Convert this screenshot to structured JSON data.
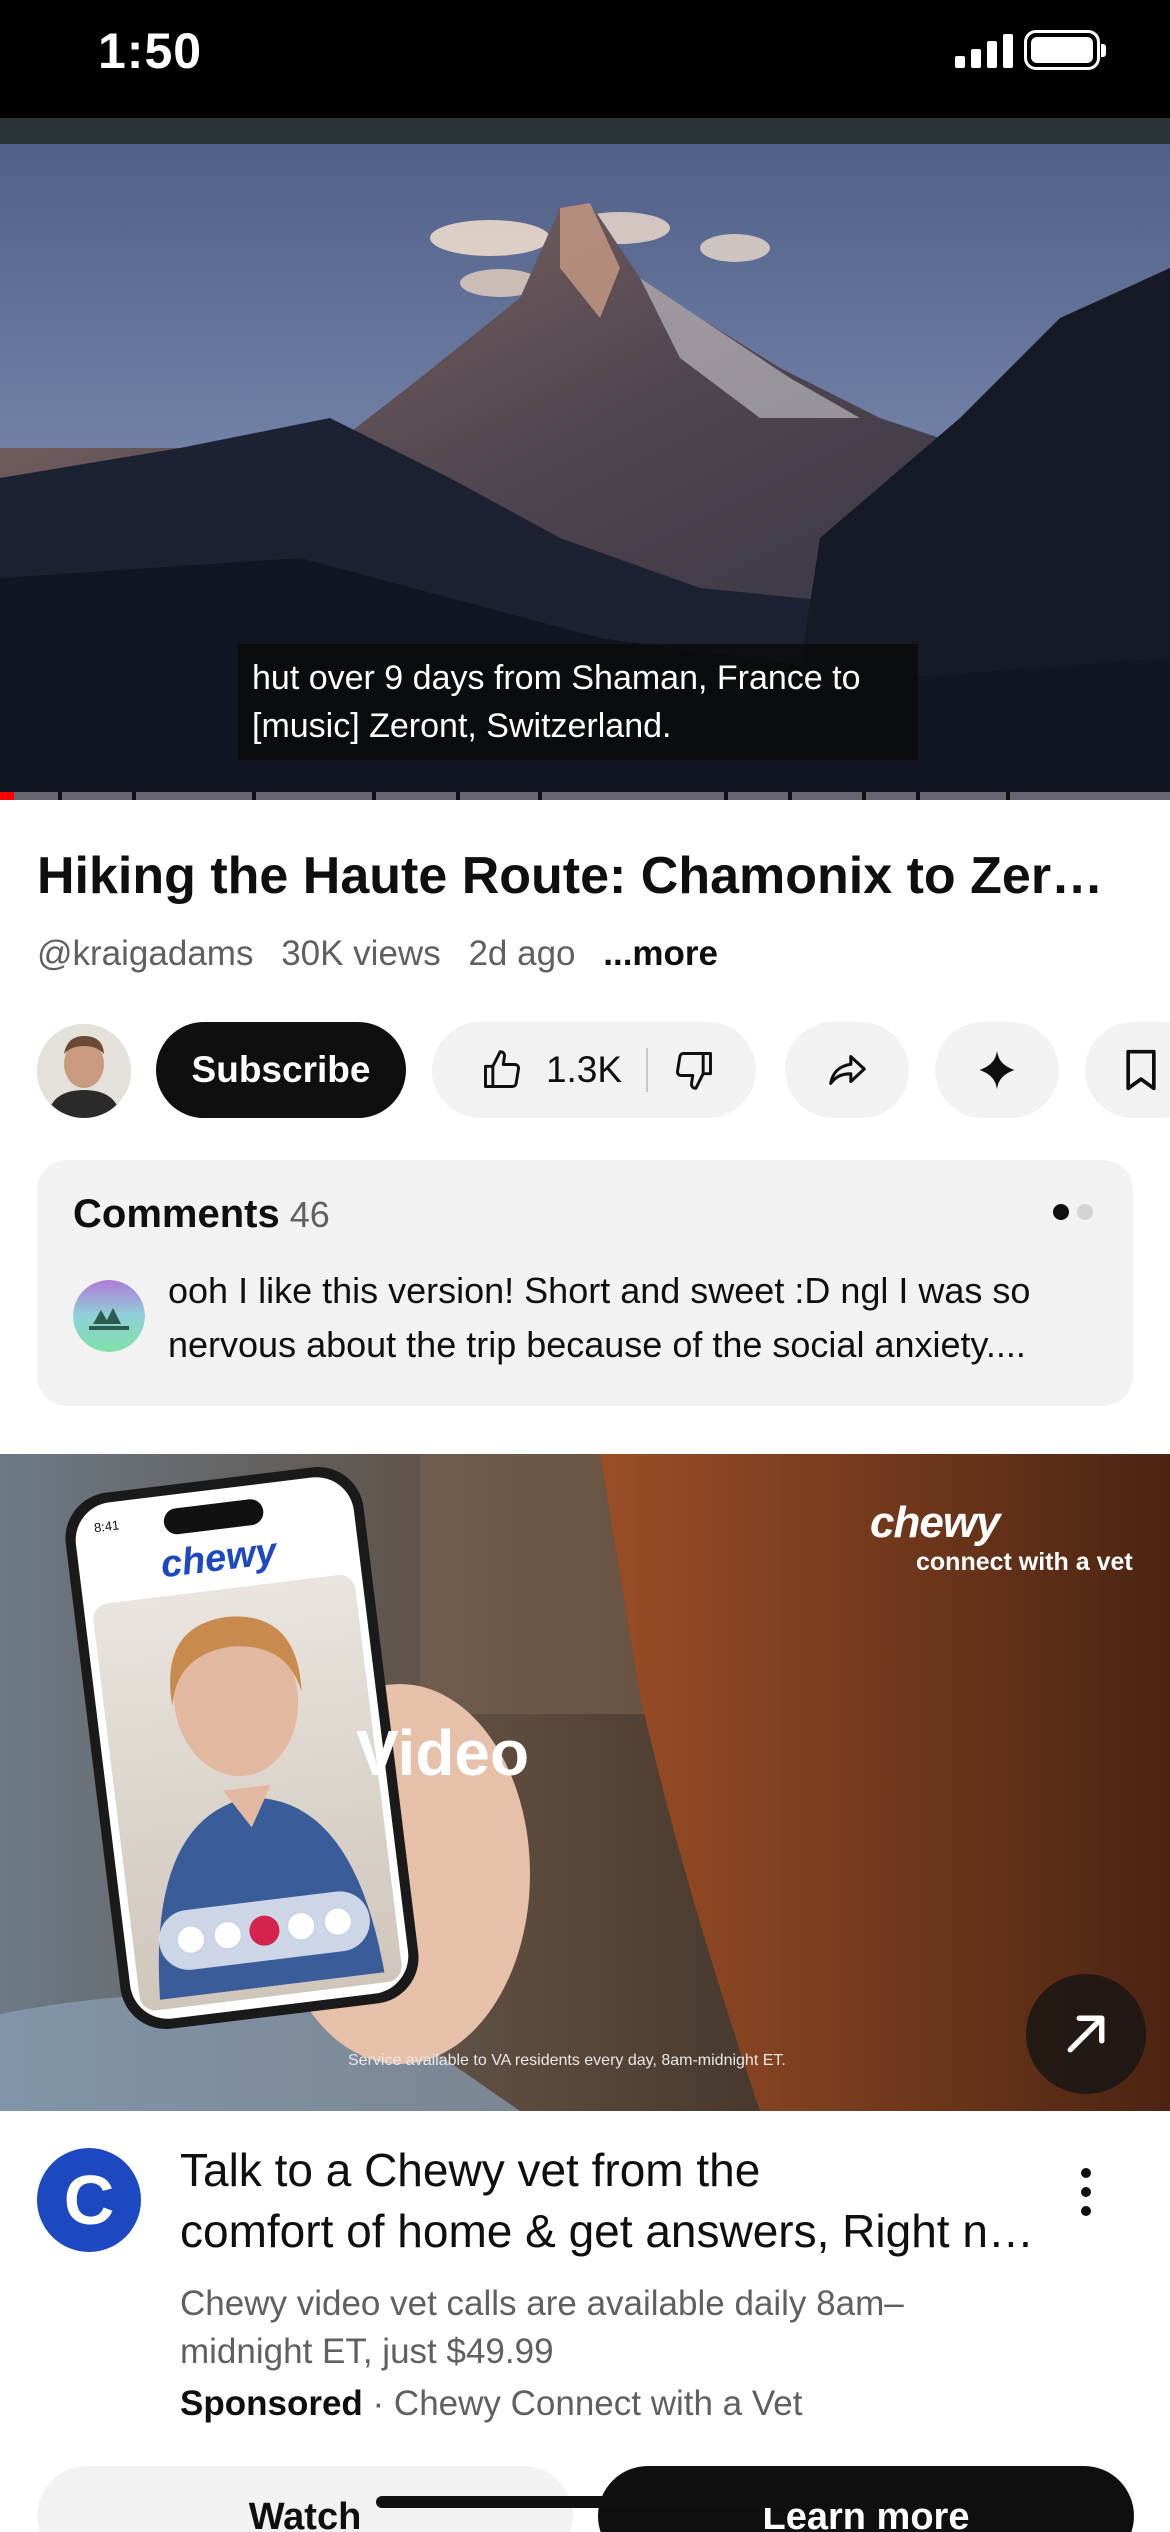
{
  "status_bar": {
    "time": "1:50"
  },
  "player": {
    "caption_lines": [
      "hut over 9 days from Shaman, France to",
      "[music] Zeront, Switzerland."
    ],
    "progress_fraction": 0.012
  },
  "video": {
    "title": "Hiking the Haute Route: Chamonix to Zermatt",
    "channel_handle": "@kraigadams",
    "views": "30K views",
    "age": "2d ago",
    "more_label": "...more"
  },
  "actions": {
    "subscribe_label": "Subscribe",
    "like_count": "1.3K"
  },
  "comments": {
    "heading": "Comments",
    "count": "46",
    "preview_lines": [
      "ooh I like this version! Short and sweet :D ngl I was so",
      "nervous about the trip because of the social anxiety...."
    ]
  },
  "ad": {
    "brand_logo_text": "chewy",
    "tagline": "connect with a vet",
    "overlay_word": "Video",
    "fine_print": "Service available to VA residents every day, 8am-midnight ET.",
    "phone_logo_text": "chewy",
    "phone_time": "8:41",
    "advertiser_initial": "C",
    "title_lines": [
      "Talk to a Chewy vet from the",
      "comfort of home & get answers, Right now"
    ],
    "description_lines": [
      "Chewy video vet calls are available daily 8am–",
      "midnight ET, just $49.99"
    ],
    "sponsored_label": "Sponsored",
    "separator": "·",
    "advertiser_name": "Chewy Connect with a Vet",
    "watch_label": "Watch",
    "learn_more_label": "Learn more"
  },
  "colors": {
    "accent_red": "#ff0000",
    "chewy_blue": "#1c49c2",
    "button_dark": "#0f0f0f",
    "chip_gray": "#f2f2f2"
  },
  "icons": [
    "signal-icon",
    "battery-icon",
    "like-icon",
    "dislike-icon",
    "share-icon",
    "ai-sparkle-icon",
    "save-icon",
    "open-external-icon",
    "more-vert-icon"
  ]
}
